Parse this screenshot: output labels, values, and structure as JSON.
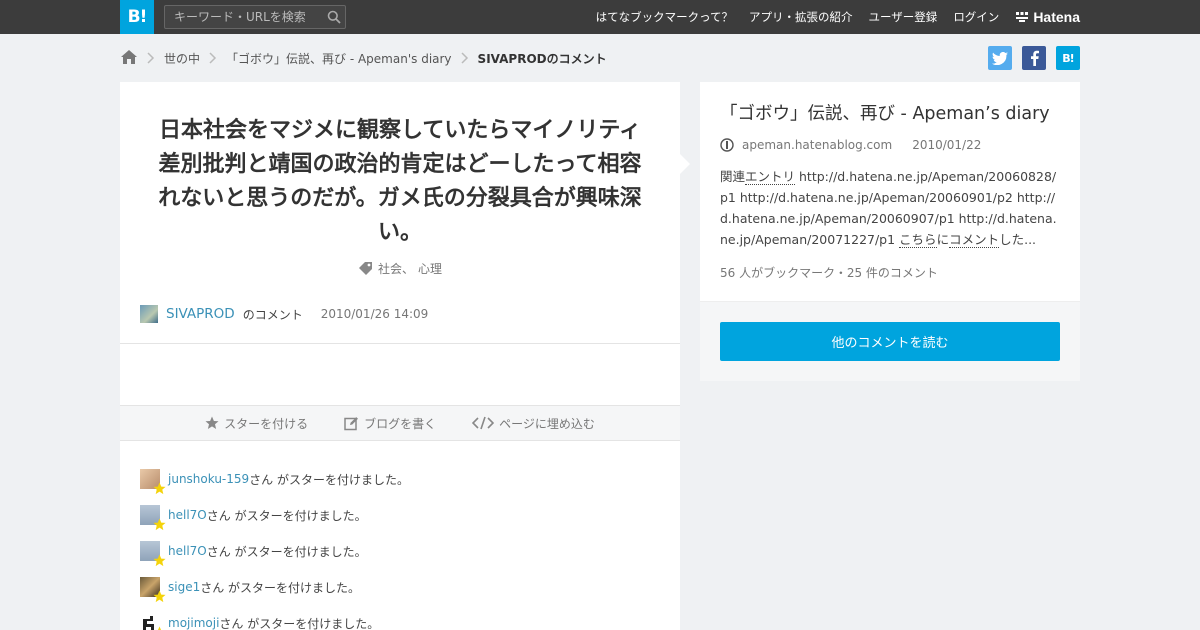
{
  "header": {
    "logo": "B!",
    "search_placeholder": "キーワード・URLを検索",
    "nav": [
      "はてなブックマークって？",
      "アプリ・拡張の紹介",
      "ユーザー登録",
      "ログイン"
    ],
    "brand": "Hatena"
  },
  "breadcrumb": {
    "items": [
      "世の中",
      "「ゴボウ」伝説、再び - Apeman's diary"
    ],
    "current": "SIVAPRODのコメント"
  },
  "comment": {
    "text": "日本社会をマジメに観察していたらマイノリティ差別批判と靖国の政治的肯定はどーしたって相容れないと思うのだが。ガメ氏の分裂具合が興味深い。",
    "tags": [
      "社会、",
      "心理"
    ],
    "user": "SIVAPROD",
    "user_suffix": "のコメント",
    "date": "2010/01/26 14:09"
  },
  "actions": {
    "star": "スターを付ける",
    "blog": "ブログを書く",
    "embed": "ページに埋め込む"
  },
  "stars": {
    "suffix": "さん がスターを付けました。",
    "users": [
      "junshoku-159",
      "hell7O",
      "hell7O",
      "sige1",
      "mojimoji"
    ]
  },
  "entry": {
    "title": "「ゴボウ」伝説、再び - Apeman’s diary",
    "domain": "apeman.hatenablog.com",
    "date": "2010/01/22",
    "desc_prefix": "関連",
    "desc_link1": "エントリ",
    "desc_urls": " http://d.hatena.ne.jp/Apeman/20060828/p1 http://d.hatena.ne.jp/Apeman/20060901/p2 http://d.hatena.ne.jp/Apeman/20060907/p1 http://d.hatena.ne.jp/Apeman/20071227/p1 ",
    "desc_link2": "こちら",
    "desc_mid": "に",
    "desc_link3": "コメント",
    "desc_suffix": "した...",
    "count": "56 人がブックマーク・25 件のコメント"
  },
  "more_button": "他のコメントを読む",
  "colors": {
    "accent": "#00a4de",
    "link": "#3b91b7",
    "topbar": "#3c3c3c"
  }
}
